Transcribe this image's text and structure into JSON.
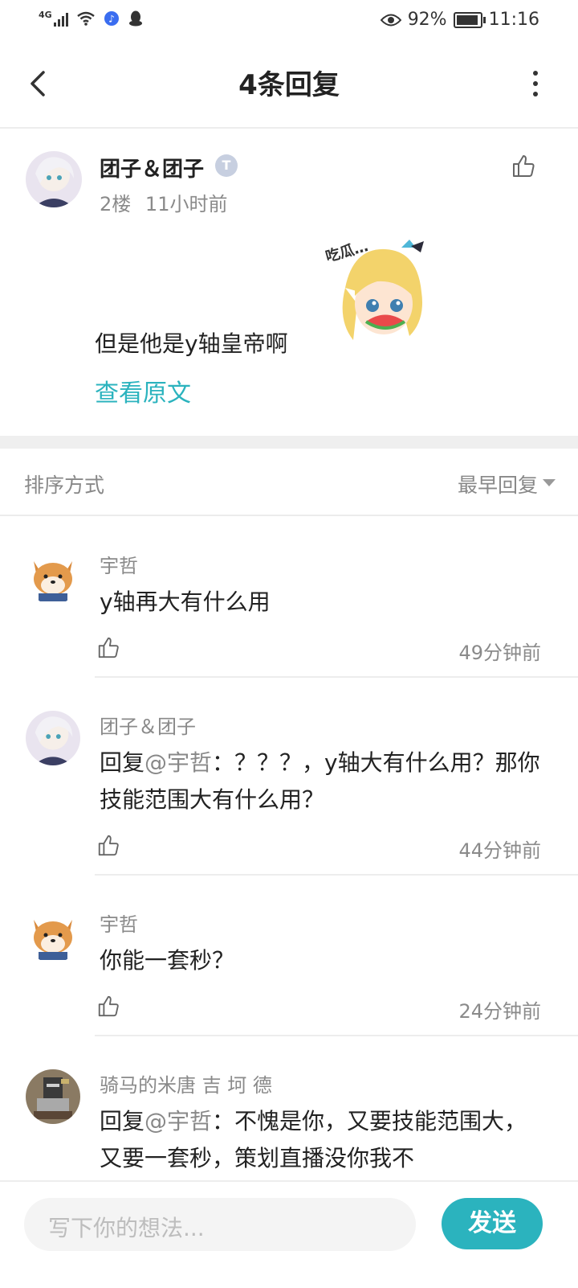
{
  "status_bar": {
    "network": "4G",
    "battery": "92%",
    "battery_level": 0.92,
    "time": "11:16"
  },
  "header": {
    "title": "4条回复"
  },
  "post": {
    "author": "团子＆团子",
    "level_badge": "T",
    "floor": "2楼",
    "time": "11小时前",
    "text": "但是他是y轴皇帝啊",
    "view_original": "查看原文"
  },
  "sort": {
    "label": "排序方式",
    "value": "最早回复"
  },
  "replies": [
    {
      "author": "宇哲",
      "text": "y轴再大有什么用",
      "time": "49分钟前",
      "avatar": "shiba-dog"
    },
    {
      "author": "团子＆团子",
      "reply_prefix": "回复",
      "mention": "@宇哲",
      "text": "：？？？，y轴大有什么用？那你技能范围大有什么用？",
      "time": "44分钟前",
      "avatar": "anime-girl"
    },
    {
      "author": "宇哲",
      "text": "你能一套秒？",
      "time": "24分钟前",
      "avatar": "shiba-dog"
    },
    {
      "author": "骑马的米唐 吉 坷 德",
      "reply_prefix": "回复",
      "mention": "@宇哲",
      "text": "：不愧是你，又要技能范围大，又要一套秒，策划直播没你我不",
      "avatar": "pixel-knight"
    }
  ],
  "composer": {
    "placeholder": "写下你的想法...",
    "send_label": "发送"
  },
  "colors": {
    "accent": "#2bb3be",
    "muted": "#8a8a8a",
    "text": "#222222"
  }
}
